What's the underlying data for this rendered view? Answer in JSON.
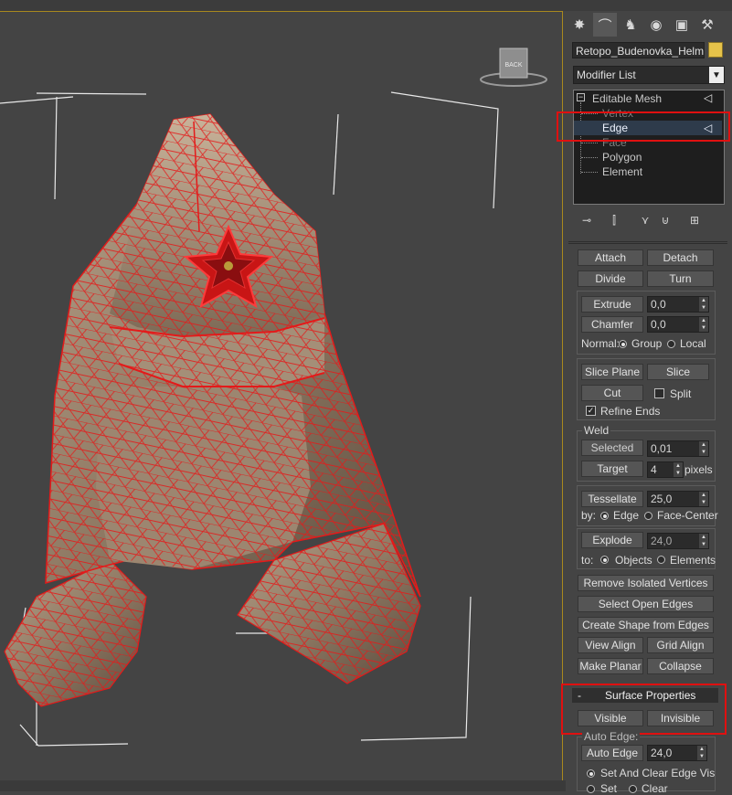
{
  "viewport": {
    "viewcube_label": "BACK"
  },
  "command_panel": {
    "tabs": [
      {
        "name": "create-tab-icon",
        "glyph": "✸"
      },
      {
        "name": "modify-tab-icon",
        "glyph": "⌒"
      },
      {
        "name": "hierarchy-tab-icon",
        "glyph": "♞"
      },
      {
        "name": "motion-tab-icon",
        "glyph": "◉"
      },
      {
        "name": "display-tab-icon",
        "glyph": "▣"
      },
      {
        "name": "utilities-tab-icon",
        "glyph": "⚒"
      }
    ],
    "object_name": "Retopo_Budenovka_Helmet",
    "object_color": "#e6c34a",
    "modifier_list": "Modifier List",
    "stack": {
      "root": "Editable Mesh",
      "sublevels": [
        "Vertex",
        "Edge",
        "Face",
        "Polygon",
        "Element"
      ],
      "selected": "Edge"
    }
  },
  "edit_geometry": {
    "attach": "Attach",
    "detach": "Detach",
    "divide": "Divide",
    "turn": "Turn",
    "extrude": "Extrude",
    "extrude_value": "0,0",
    "chamfer": "Chamfer",
    "chamfer_value": "0,0",
    "normal_label": "Normal:",
    "group": "Group",
    "local": "Local",
    "slice_plane": "Slice Plane",
    "slice": "Slice",
    "cut": "Cut",
    "split": "Split",
    "refine_ends": "Refine Ends",
    "weld_label": "Weld",
    "selected": "Selected",
    "selected_value": "0,01",
    "target": "Target",
    "target_value": "4",
    "pixels": "pixels",
    "tessellate": "Tessellate",
    "tessellate_value": "25,0",
    "by_label": "by:",
    "edge": "Edge",
    "face_center": "Face-Center",
    "explode": "Explode",
    "explode_value": "24,0",
    "to_label": "to:",
    "objects": "Objects",
    "elements": "Elements",
    "remove_isolated": "Remove Isolated Vertices",
    "select_open_edges": "Select Open Edges",
    "create_shape": "Create Shape from Edges",
    "view_align": "View Align",
    "grid_align": "Grid Align",
    "make_planar": "Make Planar",
    "collapse": "Collapse"
  },
  "surface_properties": {
    "title": "Surface Properties",
    "collapse_sign": "-",
    "visible": "Visible",
    "invisible": "Invisible",
    "auto_edge_label": "Auto Edge:",
    "auto_edge": "Auto Edge",
    "auto_edge_value": "24,0",
    "set_and_clear": "Set And Clear Edge Vis",
    "set": "Set",
    "clear": "Clear"
  },
  "colors": {
    "highlight_box": "#e01010",
    "viewport_border": "#a8891e",
    "wire": "#e41a1a"
  }
}
